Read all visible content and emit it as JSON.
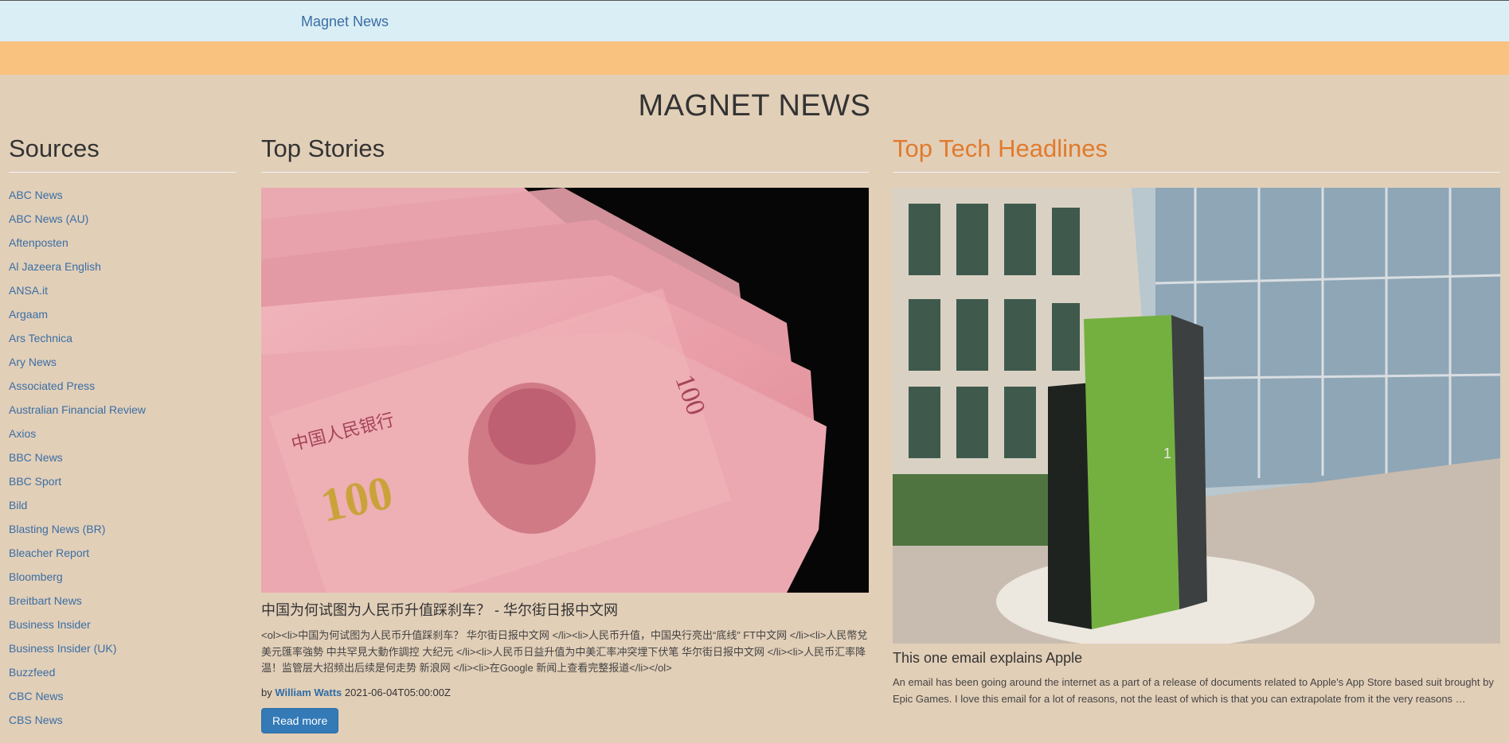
{
  "nav": {
    "brand": "Magnet News"
  },
  "site": {
    "title": "MAGNET NEWS"
  },
  "sources": {
    "heading": "Sources",
    "items": [
      "ABC News",
      "ABC News (AU)",
      "Aftenposten",
      "Al Jazeera English",
      "ANSA.it",
      "Argaam",
      "Ars Technica",
      "Ary News",
      "Associated Press",
      "Australian Financial Review",
      "Axios",
      "BBC News",
      "BBC Sport",
      "Bild",
      "Blasting News (BR)",
      "Bleacher Report",
      "Bloomberg",
      "Breitbart News",
      "Business Insider",
      "Business Insider (UK)",
      "Buzzfeed",
      "CBC News",
      "CBS News"
    ]
  },
  "top_stories": {
    "heading": "Top Stories",
    "story": {
      "title": "中国为何试图为人民币升值踩刹车？ - 华尔街日报中文网",
      "description": "<ol><li>中国为何试图为人民币升值踩刹车？  华尔街日报中文网 </li><li>人民币升值，中国央行亮出“底线”  FT中文网 </li><li>人民幣兌美元匯率強勢 中共罕見大動作調控  大纪元 </li><li>人民币日益升值为中美汇率冲突埋下伏笔  华尔街日报中文网 </li><li>人民币汇率降温！监管层大招频出后续是何走势  新浪网 </li><li>在Google 新闻上查看完整报道</li></ol>",
      "by": "by",
      "author": "William Watts",
      "date": "2021-06-04T05:00:00Z",
      "button": "Read more"
    }
  },
  "tech": {
    "heading": "Top Tech Headlines",
    "story": {
      "title": "This one email explains Apple",
      "description": "An email has been going around the internet as a part of a release of documents related to Apple's App Store based suit brought by Epic Games. I love this email for a lot of reasons, not the least of which is that you can extrapolate from it the very reasons …"
    }
  },
  "colors": {
    "accent": "#e07b2e",
    "link": "#3a6ea5",
    "button": "#337ab7"
  }
}
